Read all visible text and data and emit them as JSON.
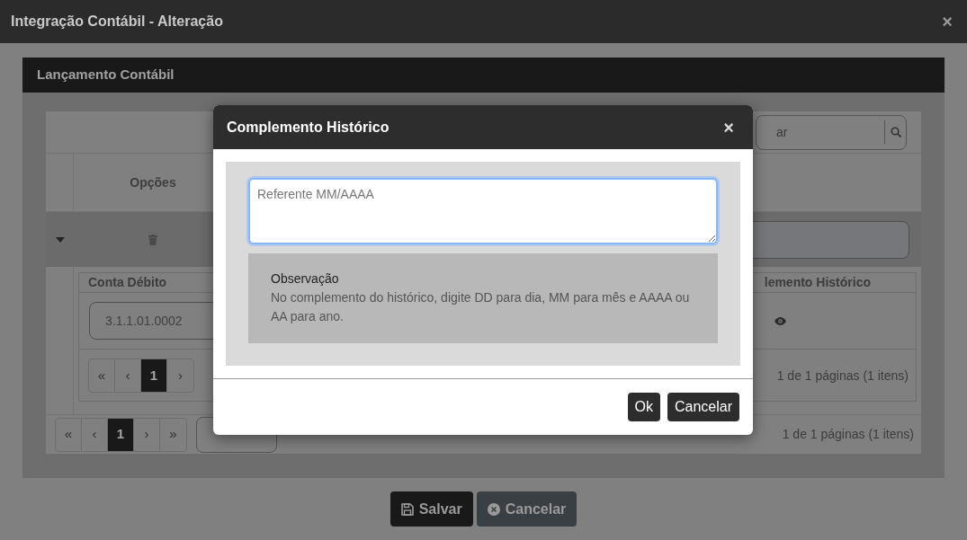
{
  "window": {
    "title": "Integração Contábil - Alteração",
    "close": "×"
  },
  "panel": {
    "title": "Lançamento Contábil",
    "search": {
      "placeholder": "ar"
    },
    "columns": [
      "Opções"
    ],
    "row": {
      "expanded": true,
      "detail": {
        "columns": [
          "Conta Débito",
          "lemento Histórico"
        ],
        "rows": [
          {
            "conta": "3.1.1.01.0002"
          }
        ],
        "pager": {
          "first": "«",
          "prev": "‹",
          "next": "›",
          "pages": [
            {
              "label": "1",
              "selected": true
            }
          ],
          "summary": "1 de 1 páginas (1 itens)"
        }
      }
    },
    "pager": {
      "first": "«",
      "prev": "‹",
      "next": "›",
      "last": "»",
      "pages": [
        {
          "label": "1",
          "selected": true
        }
      ],
      "summary": "1 de 1 páginas (1 itens)"
    }
  },
  "buttons": [
    {
      "label": "Salvar",
      "kind": "save",
      "disabled": false
    },
    {
      "label": "Cancelar",
      "kind": "cancel",
      "disabled": true
    }
  ],
  "modal": {
    "title": "Complemento Histórico",
    "close": "×",
    "textarea": {
      "placeholder": "Referente MM/AAAA",
      "focused": true
    },
    "note": {
      "title": "Observação",
      "text": "No complemento do histórico, digite DD para dia, MM para mês e AAAA ou AA para ano."
    },
    "buttons": [
      {
        "label": "Ok"
      },
      {
        "label": "Cancelar"
      }
    ]
  }
}
